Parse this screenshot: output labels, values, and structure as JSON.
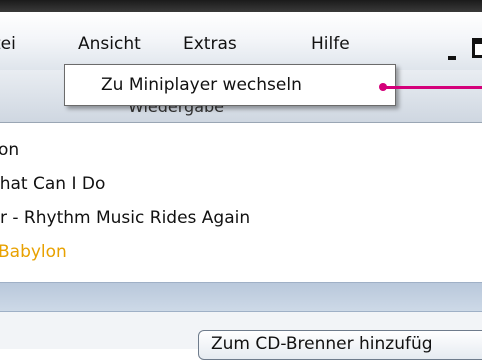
{
  "menu": {
    "items": [
      {
        "label": "tei"
      },
      {
        "label": "Ansicht"
      },
      {
        "label": "Extras"
      },
      {
        "label": "Hilfe"
      }
    ]
  },
  "header": {
    "label": "Wiedergabe"
  },
  "popup": {
    "item": "Zu Miniplayer wechseln"
  },
  "playlist": {
    "tracks": [
      {
        "title": "on"
      },
      {
        "title": "/hat Can I Do"
      },
      {
        "title": "r - Rhythm Music Rides Again"
      },
      {
        "title": "Babylon"
      }
    ],
    "active_index": 3,
    "active_color": "#e8a100"
  },
  "bottom": {
    "burn_button": "Zum CD-Brenner hinzufüg"
  },
  "colors": {
    "callout": "#d4007a"
  }
}
